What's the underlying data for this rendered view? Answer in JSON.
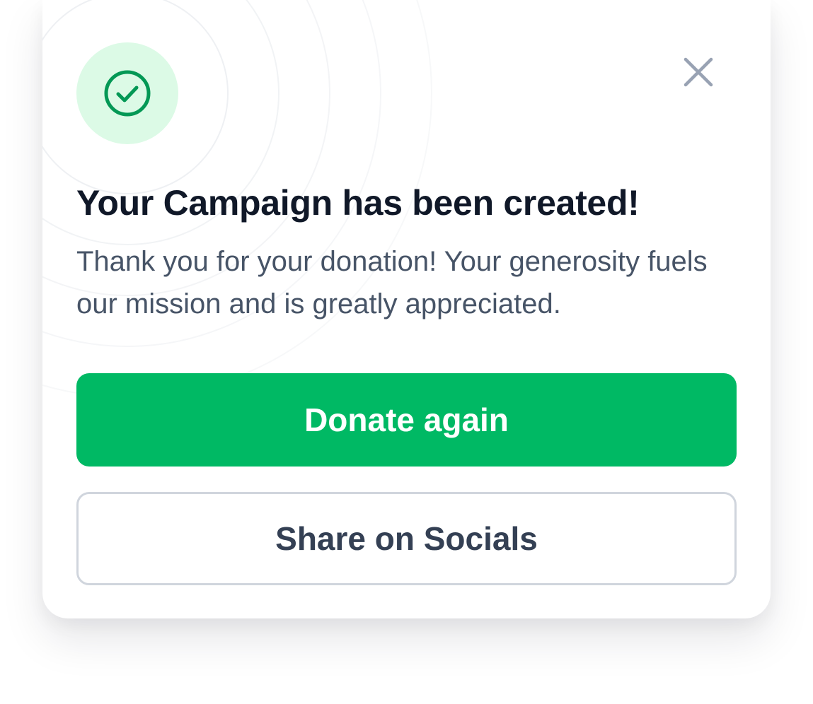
{
  "modal": {
    "title": "Your Campaign has been created!",
    "message": "Thank you for your donation! Your generosity fuels our mission and is greatly appreciated.",
    "status_icon": "check-circle-icon",
    "close_icon": "close-icon"
  },
  "actions": {
    "primary_label": "Donate again",
    "secondary_label": "Share on Socials"
  },
  "colors": {
    "accent": "#00B964",
    "icon_stroke": "#039855",
    "icon_bg": "#DCFAE6",
    "close_icon": "#98A2B3",
    "title": "#101828",
    "body_text": "#475467",
    "secondary_text": "#344054",
    "secondary_border": "#D0D5DD"
  }
}
